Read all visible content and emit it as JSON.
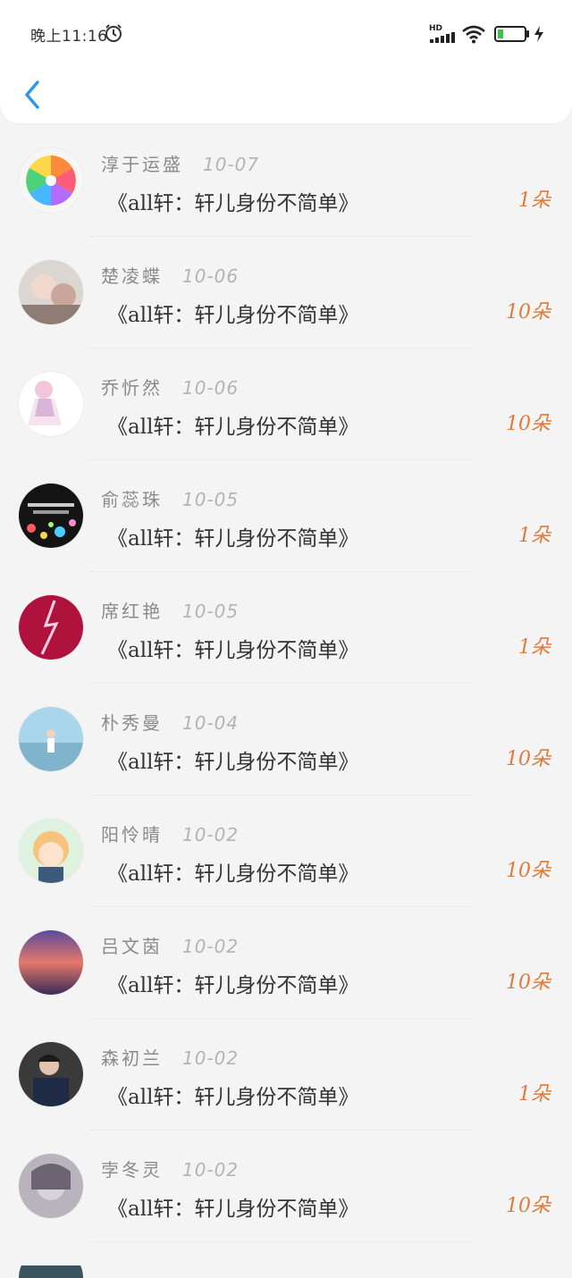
{
  "status_bar": {
    "time": "晚上11:16",
    "network_label": "HD"
  },
  "colors": {
    "accent_back": "#2e95ea",
    "count_color": "#e07a3a",
    "battery_fill": "#3bc24a"
  },
  "list": [
    {
      "name": "淳于运盛",
      "date": "10-07",
      "message": "《all轩：轩儿身份不简单》",
      "count": "1朵"
    },
    {
      "name": "楚凌蝶",
      "date": "10-06",
      "message": "《all轩：轩儿身份不简单》",
      "count": "10朵"
    },
    {
      "name": "乔忻然",
      "date": "10-06",
      "message": "《all轩：轩儿身份不简单》",
      "count": "10朵"
    },
    {
      "name": "俞蕊珠",
      "date": "10-05",
      "message": "《all轩：轩儿身份不简单》",
      "count": "1朵"
    },
    {
      "name": "席红艳",
      "date": "10-05",
      "message": "《all轩：轩儿身份不简单》",
      "count": "1朵"
    },
    {
      "name": "朴秀曼",
      "date": "10-04",
      "message": "《all轩：轩儿身份不简单》",
      "count": "10朵"
    },
    {
      "name": "阳怜晴",
      "date": "10-02",
      "message": "《all轩：轩儿身份不简单》",
      "count": "10朵"
    },
    {
      "name": "吕文茵",
      "date": "10-02",
      "message": "《all轩：轩儿身份不简单》",
      "count": "10朵"
    },
    {
      "name": "森初兰",
      "date": "10-02",
      "message": "《all轩：轩儿身份不简单》",
      "count": "1朵"
    },
    {
      "name": "孛冬灵",
      "date": "10-02",
      "message": "《all轩：轩儿身份不简单》",
      "count": "10朵"
    }
  ]
}
